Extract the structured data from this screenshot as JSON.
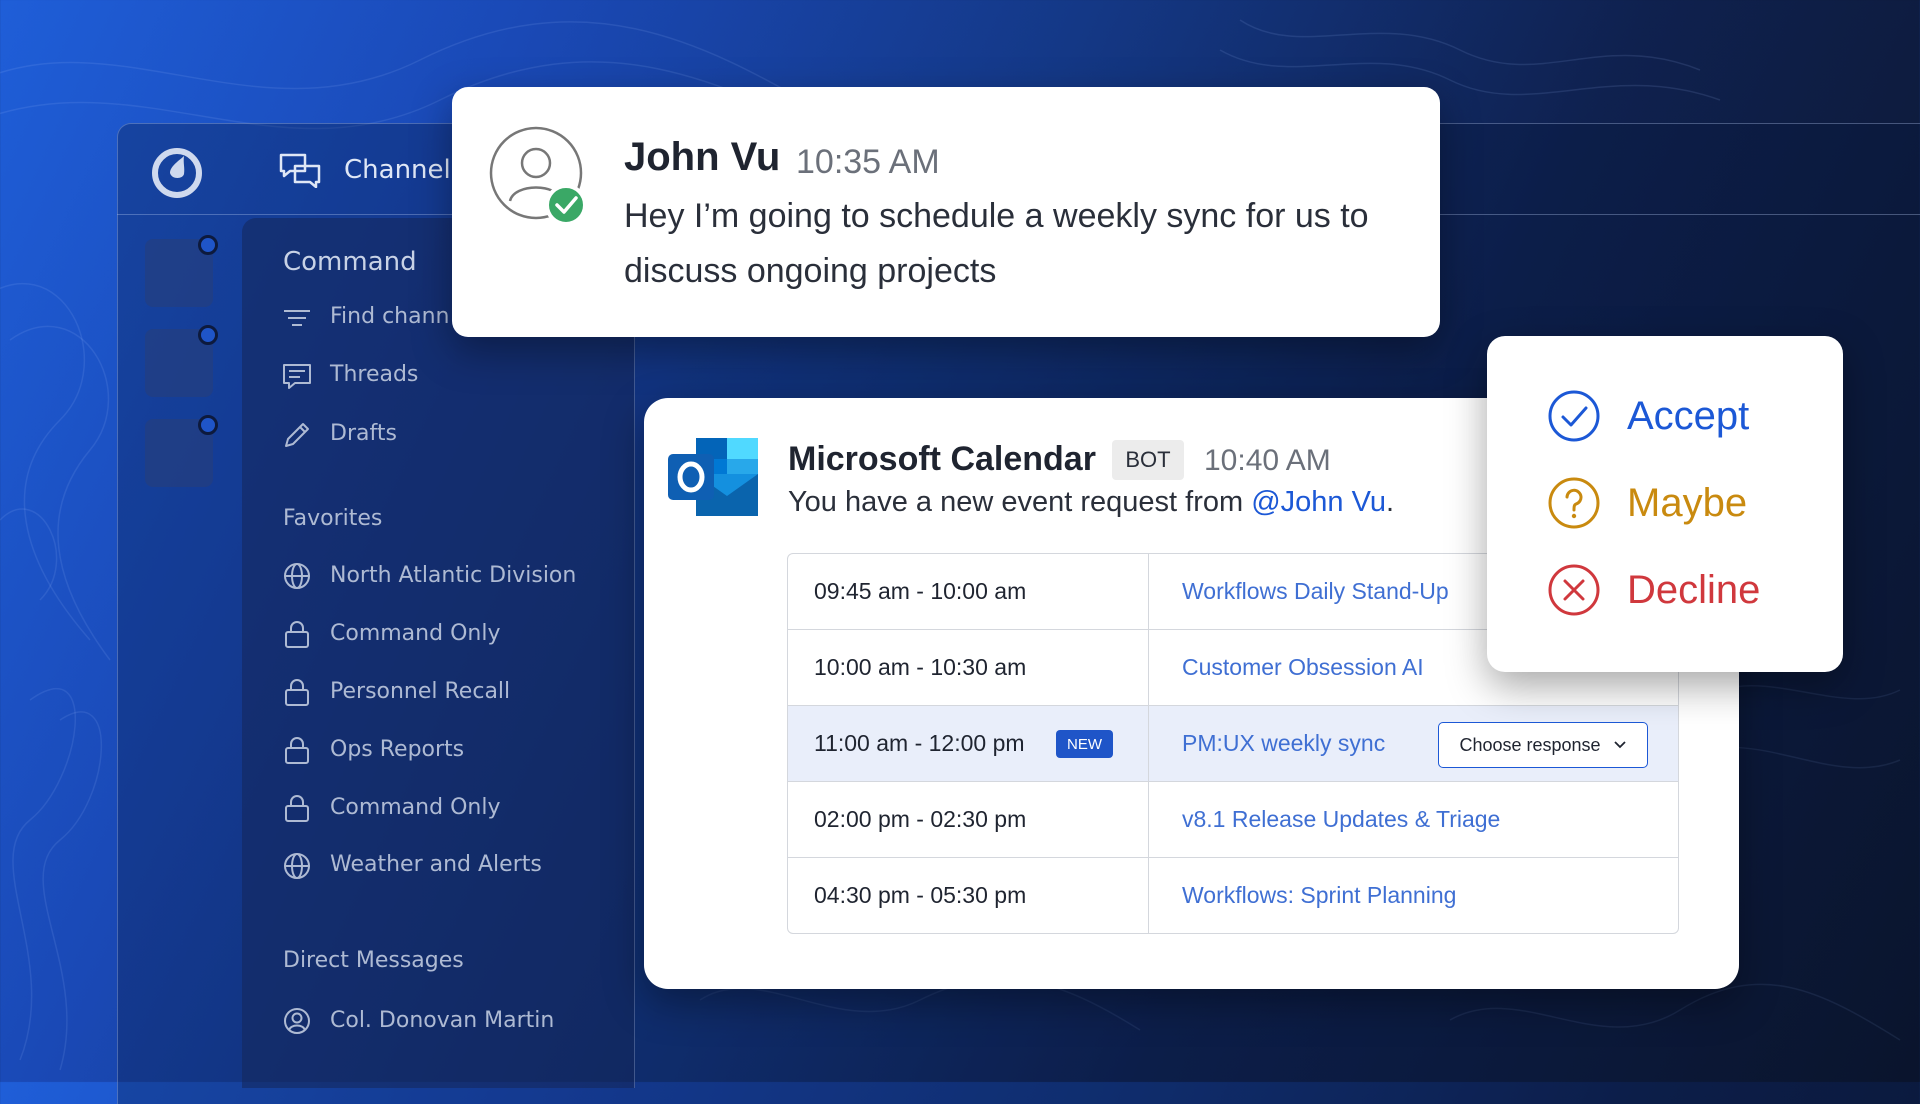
{
  "topbar": {
    "channels_label": "Channels"
  },
  "sidebar": {
    "header": "Command",
    "items": [
      {
        "label": "Find channels",
        "icon": "filter-icon"
      },
      {
        "label": "Threads",
        "icon": "threads-icon"
      },
      {
        "label": "Drafts",
        "icon": "pencil-icon"
      }
    ],
    "favorites_heading": "Favorites",
    "favorites": [
      {
        "label": "North Atlantic Division",
        "icon": "globe-icon"
      },
      {
        "label": "Command Only",
        "icon": "lock-icon"
      },
      {
        "label": "Personnel Recall",
        "icon": "lock-icon"
      },
      {
        "label": "Ops Reports",
        "icon": "lock-icon"
      },
      {
        "label": "Command Only",
        "icon": "lock-icon"
      },
      {
        "label": "Weather and Alerts",
        "icon": "globe-icon"
      }
    ],
    "dm_heading": "Direct Messages",
    "dms": [
      {
        "label": "Col. Donovan Martin",
        "icon": "user-icon"
      }
    ]
  },
  "message": {
    "author": "John Vu",
    "time": "10:35 AM",
    "body": "Hey I’m going to schedule a weekly sync for us to discuss ongoing projects",
    "status_color": "#3aa866"
  },
  "calendar": {
    "title": "Microsoft Calendar",
    "badge": "BOT",
    "time": "10:40 AM",
    "description": "You have a new event request from ",
    "mention": "@John Vu",
    "description_end": ".",
    "events": [
      {
        "time": "09:45 am - 10:00 am",
        "name": "Workflows Daily Stand-Up",
        "new": false
      },
      {
        "time": "10:00 am - 10:30 am",
        "name": "Customer Obsession AI",
        "new": false
      },
      {
        "time": "11:00 am - 12:00 pm",
        "name": "PM:UX weekly sync",
        "new": true,
        "new_label": "NEW"
      },
      {
        "time": "02:00 pm - 02:30 pm",
        "name": "v8.1 Release Updates & Triage",
        "new": false
      },
      {
        "time": "04:30 pm - 05:30 pm",
        "name": "Workflows: Sprint Planning",
        "new": false
      }
    ],
    "response_button": "Choose response"
  },
  "responses": [
    {
      "label": "Accept",
      "color": "#1c58d6",
      "icon": "check-circle-icon"
    },
    {
      "label": "Maybe",
      "color": "#c98a0f",
      "icon": "question-circle-icon"
    },
    {
      "label": "Decline",
      "color": "#d0383d",
      "icon": "x-circle-icon"
    }
  ]
}
